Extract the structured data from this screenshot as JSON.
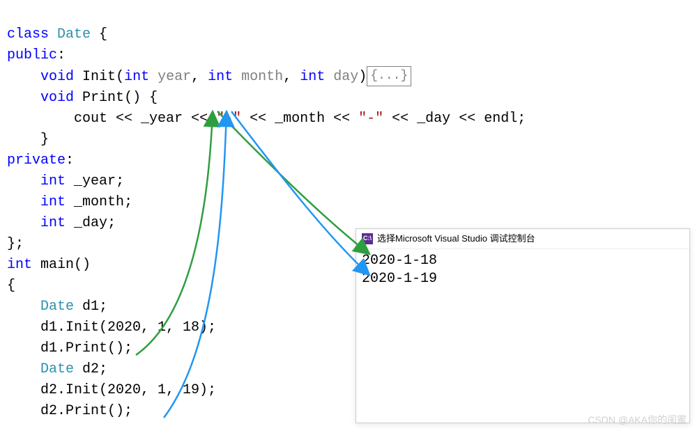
{
  "code": {
    "line1": {
      "kw_class": "class",
      "type": "Date",
      "brace": " {"
    },
    "line2": {
      "kw_public": "public",
      "colon": ":"
    },
    "line3": {
      "kw_void": "void",
      "fn": "Init",
      "open": "(",
      "kw_int1": "int",
      "p1": "year",
      "c1": ", ",
      "kw_int2": "int",
      "p2": "month",
      "c2": ", ",
      "kw_int3": "int",
      "p3": "day",
      "close": ")",
      "fold": "{...}"
    },
    "line4": {
      "kw_void": "void",
      "fn": "Print",
      "parens": "()",
      "brace": " {"
    },
    "line5": {
      "cout": "cout",
      "op1": " << ",
      "y": "_year",
      "op2": " << ",
      "s1": "\"-\"",
      "op3": " << ",
      "m": "_month",
      "op4": " << ",
      "s2": "\"-\"",
      "op5": " << ",
      "d": "_day",
      "op6": " << ",
      "endl": "endl",
      "semi": ";"
    },
    "line6": {
      "brace": "}"
    },
    "line7": {
      "kw_private": "private",
      "colon": ":"
    },
    "line8": {
      "kw_int": "int",
      "name": "_year",
      "semi": ";"
    },
    "line9": {
      "kw_int": "int",
      "name": "_month",
      "semi": ";"
    },
    "line10": {
      "kw_int": "int",
      "name": "_day",
      "semi": ";"
    },
    "line11": {
      "text": "};"
    },
    "line12": {
      "kw_int": "int",
      "fn": "main",
      "parens": "()"
    },
    "line13": {
      "text": "{"
    },
    "line14": {
      "type": "Date",
      "var": "d1",
      "semi": ";"
    },
    "line15": {
      "text": "d1.Init(2020, 1, 18);"
    },
    "line16": {
      "text": "d1.Print();"
    },
    "line17": {
      "type": "Date",
      "var": "d2",
      "semi": ";"
    },
    "line18": {
      "text": "d2.Init(2020, 1, 19);"
    },
    "line19": {
      "text": "d2.Print();"
    }
  },
  "console": {
    "title": "选择Microsoft Visual Studio 调试控制台",
    "icon_text": "C:\\",
    "line1": "2020-1-18",
    "line2": "2020-1-19"
  },
  "watermark": "CSDN @AKA你的闺蜜"
}
